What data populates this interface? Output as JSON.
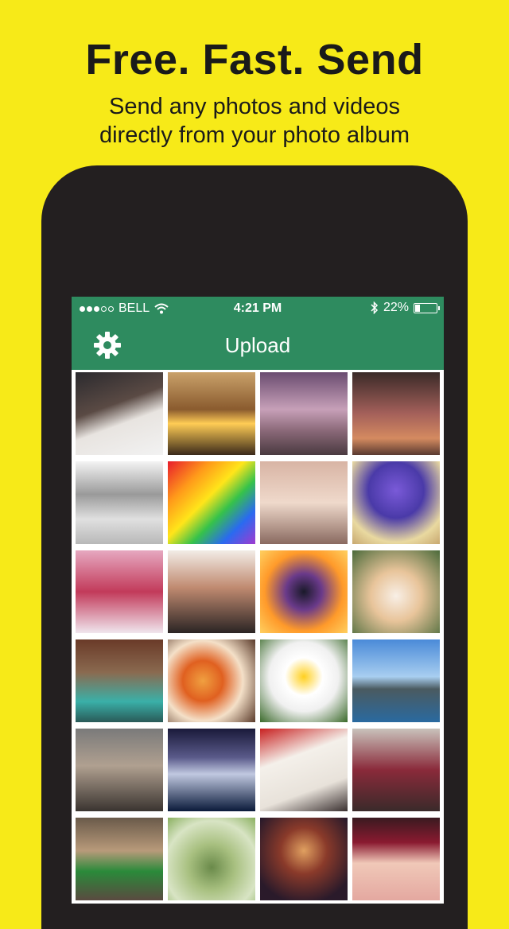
{
  "promo": {
    "headline": "Free. Fast. Send",
    "subline_1": "Send any photos and videos",
    "subline_2": "directly from your photo album"
  },
  "status_bar": {
    "carrier": "BELL",
    "signal_bars_filled": 3,
    "signal_bars_total": 5,
    "time": "4:21 PM",
    "battery": "22%",
    "battery_level": 0.22
  },
  "navbar": {
    "title": "Upload",
    "settings_icon": "gear-icon"
  },
  "colors": {
    "background": "#f7ea18",
    "accent": "#2e8b5f",
    "phone": "#231f20"
  },
  "photos": [
    {
      "subject": "young man portrait"
    },
    {
      "subject": "hair flip at sunset"
    },
    {
      "subject": "ferris wheel"
    },
    {
      "subject": "dancers"
    },
    {
      "subject": "grey cat"
    },
    {
      "subject": "rainbow stairs"
    },
    {
      "subject": "eiffel tower"
    },
    {
      "subject": "purple flowers"
    },
    {
      "subject": "pink building"
    },
    {
      "subject": "three girls"
    },
    {
      "subject": "dandelion sunset"
    },
    {
      "subject": "pomeranian puppy"
    },
    {
      "subject": "indoor pool"
    },
    {
      "subject": "cupcakes"
    },
    {
      "subject": "daisies"
    },
    {
      "subject": "lake"
    },
    {
      "subject": "fashion street"
    },
    {
      "subject": "dark ocean"
    },
    {
      "subject": "sketch drawing"
    },
    {
      "subject": "girl with cup"
    },
    {
      "subject": "woman on stairs"
    },
    {
      "subject": "green teapot"
    },
    {
      "subject": "concert crowd"
    },
    {
      "subject": "baby photo"
    }
  ]
}
